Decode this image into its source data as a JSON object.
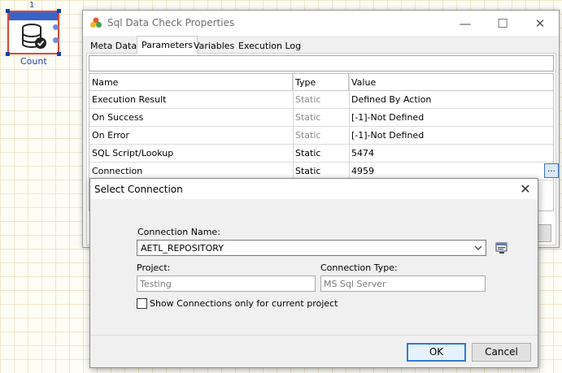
{
  "canvas": {
    "node_index": "1",
    "node_label": "Count"
  },
  "window": {
    "title": "Sql Data Check Properties",
    "minimize_glyph": "—",
    "maximize_glyph": "☐",
    "close_glyph": "✕"
  },
  "tabs": [
    "Meta Data",
    "Parameters",
    "Variables",
    "Execution Log"
  ],
  "grid": {
    "headers": [
      "Name",
      "Type",
      "Value"
    ],
    "rows": [
      {
        "name": "Execution Result",
        "type": "Static",
        "value": "Defined By Action",
        "muted_type": true
      },
      {
        "name": "On Success",
        "type": "Static",
        "value": "[-1]-Not Defined",
        "muted_type": true
      },
      {
        "name": "On Error",
        "type": "Static",
        "value": "[-1]-Not Defined",
        "muted_type": true
      },
      {
        "name": "SQL Script/Lookup",
        "type": "Static",
        "value": "5474",
        "muted_type": false
      },
      {
        "name": "Connection",
        "type": "Static",
        "value": "4959",
        "muted_type": false
      }
    ],
    "ellipsis_label": "..."
  },
  "dialog": {
    "title": "Select Connection",
    "close_glyph": "✕",
    "connection_name_label": "Connection Name:",
    "connection_name_value": "AETL_REPOSITORY",
    "project_label": "Project:",
    "project_value": "Testing",
    "connection_type_label": "Connection Type:",
    "connection_type_value": "MS Sql Server",
    "show_connections_label": "Show Connections only for current project",
    "show_connections_checked": false,
    "ok_label": "OK",
    "cancel_label": "Cancel"
  },
  "colors": {
    "node_border": "#e0462b",
    "node_header": "#3a63c8",
    "selection": "#1f3fa6",
    "ok_border": "#2f7bd0"
  },
  "icons": [
    "database-check-icon",
    "window-app-icon",
    "connection-settings-icon",
    "chevron-down-icon",
    "close-icon"
  ]
}
